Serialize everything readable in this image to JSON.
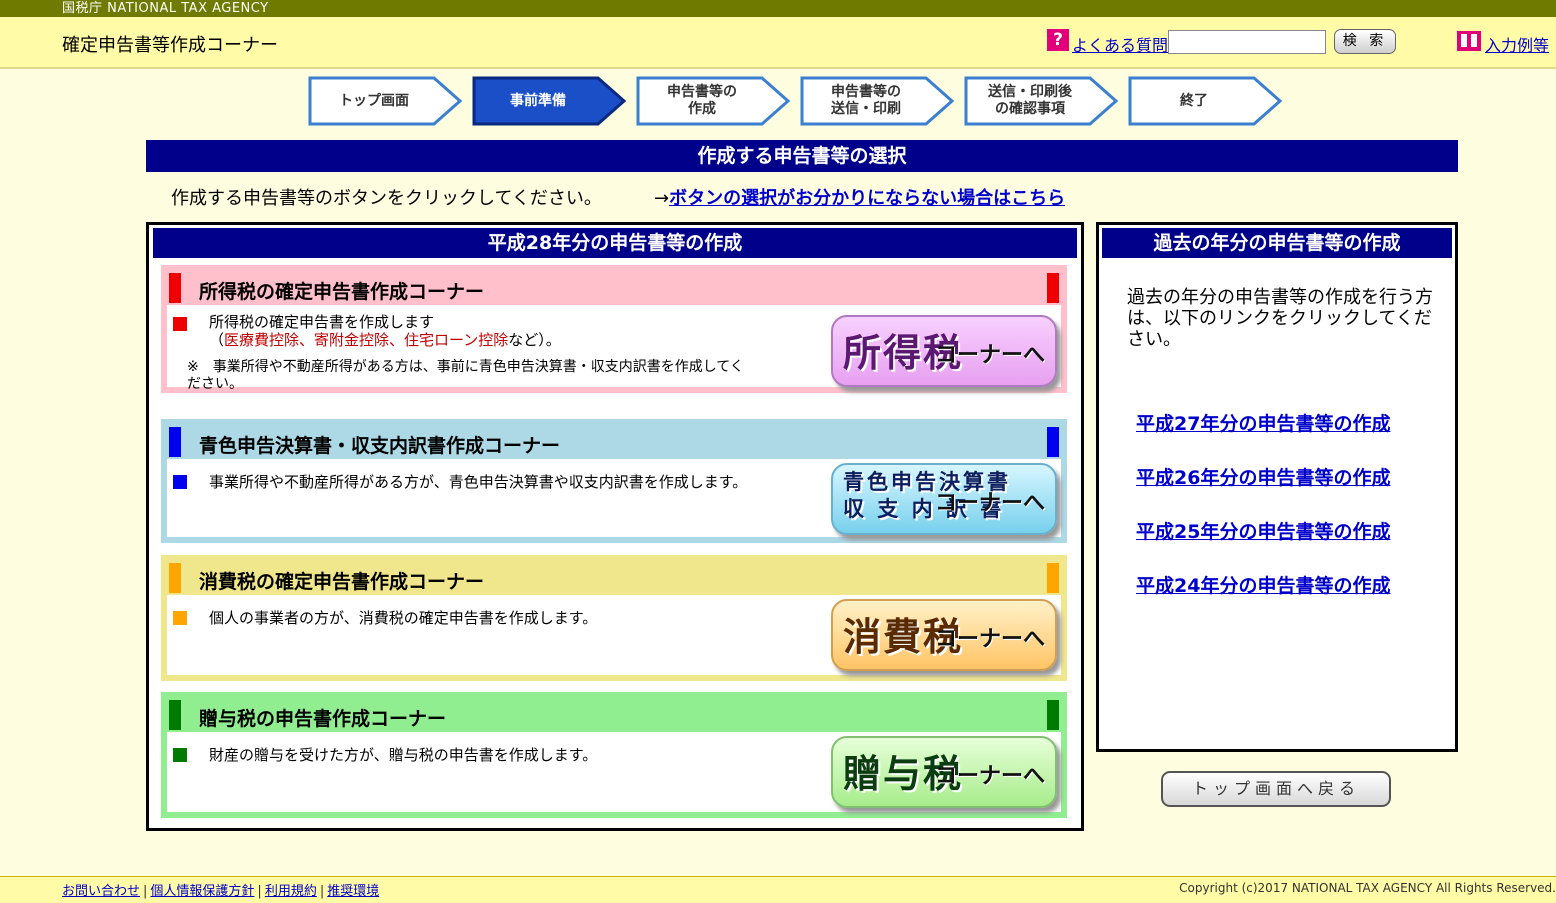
{
  "topbar": {
    "label": "国税庁  NATIONAL TAX AGENCY"
  },
  "header": {
    "title": "確定申告書等作成コーナー",
    "faq_icon": "?",
    "faq_label": "よくある質問",
    "search": {
      "value": "",
      "placeholder": ""
    },
    "search_button": "検 索",
    "example_label": "入力例等"
  },
  "steps": [
    {
      "label": "トップ画面",
      "active": false
    },
    {
      "label": "事前準備",
      "active": true
    },
    {
      "label": "申告書等の\n作成",
      "active": false
    },
    {
      "label": "申告書等の\n送信・印刷",
      "active": false
    },
    {
      "label": "送信・印刷後\nの確認事項",
      "active": false
    },
    {
      "label": "終了",
      "active": false
    }
  ],
  "main": {
    "banner": "作成する申告書等の選択",
    "instruction": "作成する申告書等のボタンをクリックしてください。",
    "help_prefix": "→",
    "help_link": "ボタンの選択がお分かりにならない場合はこちら"
  },
  "left_panel": {
    "heading": "平成28年分の申告書等の作成",
    "corners": [
      {
        "title": "所得税の確定申告書作成コーナー",
        "desc_line1": "所得税の確定申告書を作成します",
        "desc_open": "（",
        "desc_red": "医療費控除、寄附金控除、住宅ローン控除",
        "desc_close": "など）。",
        "note": "※　事業所得や不動産所得がある方は、事前に青色申告決算書・収支内訳書を作成してください。",
        "button_main": "所得税",
        "button_sub": "コーナーへ"
      },
      {
        "title": "青色申告決算書・収支内訳書作成コーナー",
        "desc": "事業所得や不動産所得がある方が、青色申告決算書や収支内訳書を作成します。",
        "button_main_line1": "青色申告決算書",
        "button_main_line2": "収 支 内 訳 書",
        "button_sub": "コーナーへ"
      },
      {
        "title": "消費税の確定申告書作成コーナー",
        "desc": "個人の事業者の方が、消費税の確定申告書を作成します。",
        "button_main": "消費税",
        "button_sub": "コーナーへ"
      },
      {
        "title": "贈与税の申告書作成コーナー",
        "desc": "財産の贈与を受けた方が、贈与税の申告書を作成します。",
        "button_main": "贈与税",
        "button_sub": "コーナーへ"
      }
    ]
  },
  "right_panel": {
    "heading": "過去の年分の申告書等の作成",
    "description": "過去の年分の申告書等の作成を行う方は、以下のリンクをクリックしてください。",
    "links": [
      "平成27年分の申告書等の作成",
      "平成26年分の申告書等の作成",
      "平成25年分の申告書等の作成",
      "平成24年分の申告書等の作成"
    ]
  },
  "back_button": "トップ画面へ戻る",
  "footer": {
    "links": [
      "お問い合わせ",
      "個人情報保護方針",
      "利用規約",
      "推奨環境"
    ],
    "separator": "|",
    "copyright": "Copyright (c)2017 NATIONAL TAX AGENCY All Rights Reserved."
  },
  "colors": {
    "navy": "#00008b",
    "income_tax": "#ffc0cb",
    "blue_return": "#add8e6",
    "consumption_tax": "#f0e68c",
    "gift_tax": "#90ee90"
  }
}
